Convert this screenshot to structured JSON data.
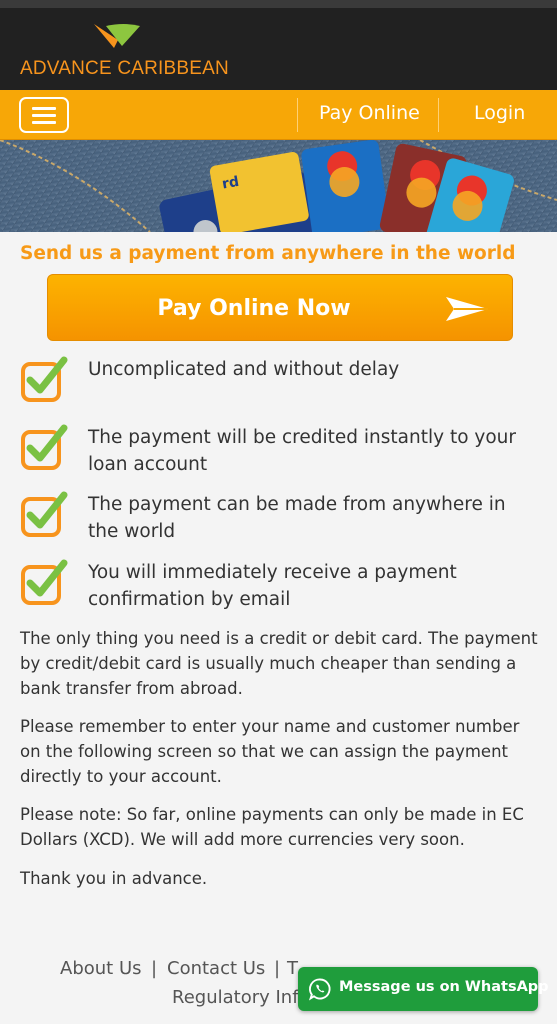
{
  "brand": {
    "name": "ADVANCE CARIBBEAN",
    "orange": "#f7a707",
    "green": "#8dc63f"
  },
  "nav": {
    "menu_icon": "hamburger-icon",
    "pay_online": "Pay Online",
    "login": "Login"
  },
  "banner": {
    "card_text": "MasterCard",
    "card_fragment": "rd"
  },
  "main": {
    "headline": "Send us a payment from anywhere in the world",
    "pay_button": "Pay Online Now",
    "checklist": [
      {
        "icon": "checkbox-checked-icon",
        "text": "Uncomplicated and without delay"
      },
      {
        "icon": "checkbox-checked-icon",
        "text": "The payment will be credited instantly to your loan account"
      },
      {
        "icon": "checkbox-checked-icon",
        "text": "The payment can be made from anywhere in the world"
      },
      {
        "icon": "checkbox-checked-icon",
        "text": "You will immediately receive a payment confirmation by email"
      }
    ],
    "paragraphs": [
      "The only thing you need is a credit or debit card. The payment by credit/debit card is usually much cheaper than sending a bank transfer from abroad.",
      "Please remember to enter your name and customer number on the following screen so that we can assign the payment directly to your account.",
      "Please note: So far, online payments can only be made in EC Dollars (XCD). We will add more currencies very soon.",
      "Thank you in advance."
    ]
  },
  "footer": {
    "about": "About Us",
    "contact": "Contact Us",
    "separator": "|",
    "terms_fragment": "T",
    "regulatory_fragment": "Regulatory Inf"
  },
  "whatsapp": {
    "label": "Message us on WhatsApp",
    "icon": "whatsapp-icon"
  }
}
